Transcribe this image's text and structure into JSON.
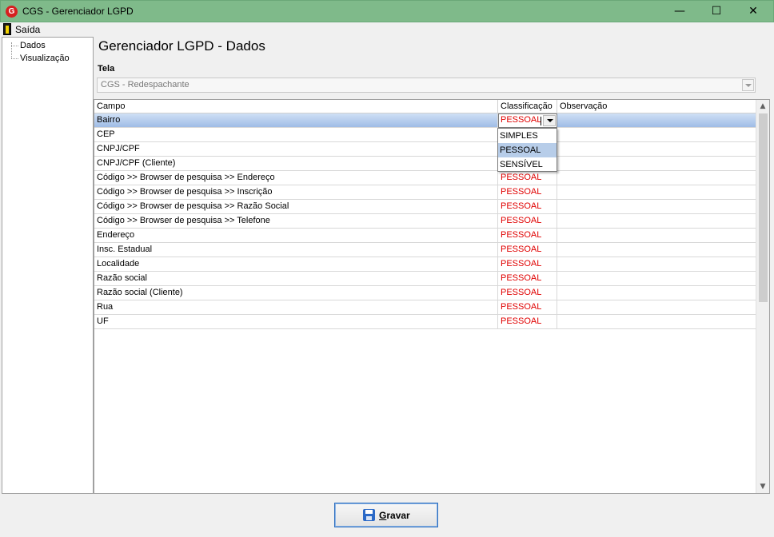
{
  "window": {
    "title": "CGS - Gerenciador LGPD",
    "app_icon_letter": "G",
    "minimize_glyph": "—",
    "maximize_glyph": "☐",
    "close_glyph": "✕"
  },
  "menu": {
    "exit_label": "Saída"
  },
  "tree": {
    "items": [
      "Dados",
      "Visualização"
    ]
  },
  "page_title": "Gerenciador LGPD - Dados",
  "tela": {
    "label": "Tela",
    "value": "CGS - Redespachante"
  },
  "grid": {
    "headers": {
      "campo": "Campo",
      "classificacao": "Classificação",
      "observacao": "Observação"
    },
    "rows": [
      {
        "campo": "Bairro",
        "classificacao": "PESSOAL",
        "observacao": ""
      },
      {
        "campo": "CEP",
        "classificacao": "",
        "observacao": ""
      },
      {
        "campo": "CNPJ/CPF",
        "classificacao": "",
        "observacao": ""
      },
      {
        "campo": "CNPJ/CPF (Cliente)",
        "classificacao": "",
        "observacao": ""
      },
      {
        "campo": "Código >> Browser de pesquisa >> Endereço",
        "classificacao": "PESSOAL",
        "observacao": ""
      },
      {
        "campo": "Código >> Browser de pesquisa >> Inscrição",
        "classificacao": "PESSOAL",
        "observacao": ""
      },
      {
        "campo": "Código >> Browser de pesquisa >> Razão Social",
        "classificacao": "PESSOAL",
        "observacao": ""
      },
      {
        "campo": "Código >> Browser de pesquisa >> Telefone",
        "classificacao": "PESSOAL",
        "observacao": ""
      },
      {
        "campo": "Endereço",
        "classificacao": "PESSOAL",
        "observacao": ""
      },
      {
        "campo": "Insc. Estadual",
        "classificacao": "PESSOAL",
        "observacao": ""
      },
      {
        "campo": "Localidade",
        "classificacao": "PESSOAL",
        "observacao": ""
      },
      {
        "campo": "Razão social",
        "classificacao": "PESSOAL",
        "observacao": ""
      },
      {
        "campo": "Razão social (Cliente)",
        "classificacao": "PESSOAL",
        "observacao": ""
      },
      {
        "campo": "Rua",
        "classificacao": "PESSOAL",
        "observacao": ""
      },
      {
        "campo": "UF",
        "classificacao": "PESSOAL",
        "observacao": ""
      }
    ],
    "dropdown_options": [
      "SIMPLES",
      "PESSOAL",
      "SENSÍVEL"
    ],
    "dropdown_highlighted": "PESSOAL"
  },
  "footer": {
    "save_label": "Gravar"
  },
  "colors": {
    "titlebar": "#7fba8a",
    "classification_text": "#e00000",
    "selected_row": "#b7cde9",
    "save_icon": "#2b69c7"
  },
  "icons": {
    "app": "cgs-logo-icon",
    "exit": "door-exit-icon",
    "save": "floppy-disk-icon",
    "dropdown": "chevron-down-icon"
  }
}
